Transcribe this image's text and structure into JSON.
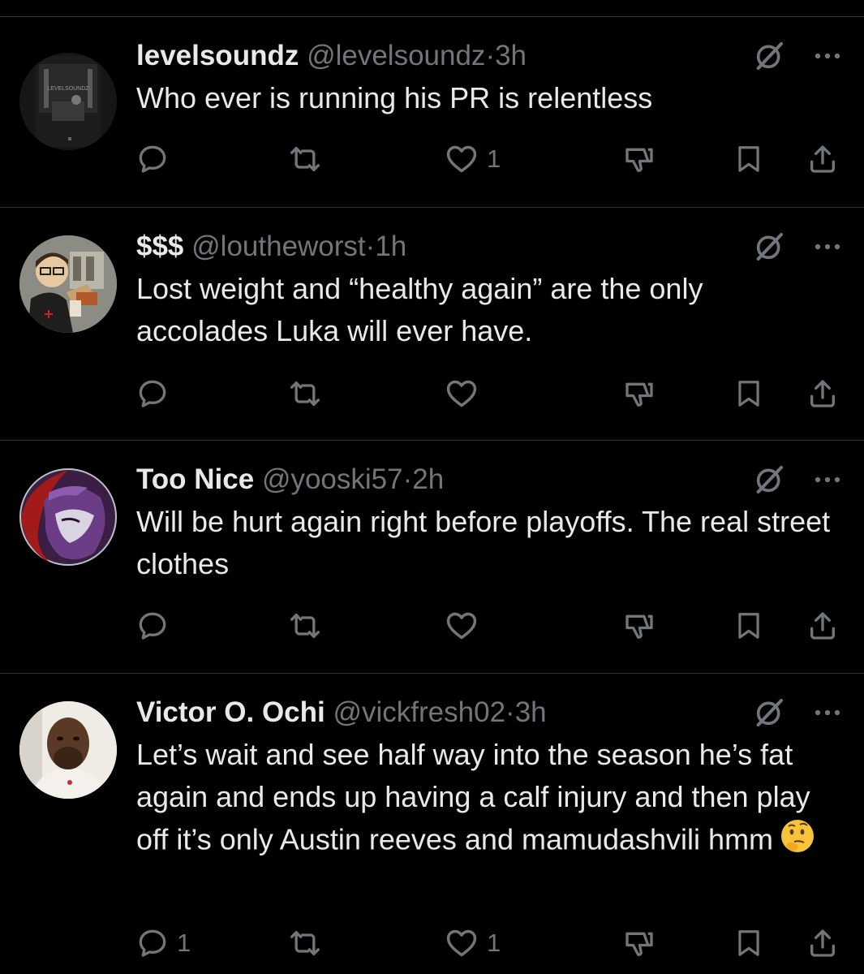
{
  "colors": {
    "background": "#000000",
    "text_primary": "#e7e9ea",
    "text_secondary": "#71767b",
    "divider": "#2f3336"
  },
  "tweets": [
    {
      "name": "levelsoundz",
      "handle": "@levelsoundz",
      "separator": "·",
      "time": "3h",
      "text": "Who ever is running his PR is relentless",
      "avatar_text": "LEVELSOUNDZ",
      "reply_count": "",
      "like_count": "1"
    },
    {
      "name": "$$$",
      "handle": "@loutheworst",
      "separator": "·",
      "time": "1h",
      "text": "Lost weight and “healthy again” are the only accolades Luka will ever have.",
      "reply_count": "",
      "like_count": ""
    },
    {
      "name": "Too Nice",
      "handle": "@yooski57",
      "separator": "·",
      "time": "2h",
      "text": "Will be hurt again right before playoffs. The real street clothes",
      "reply_count": "",
      "like_count": ""
    },
    {
      "name": "Victor O. Ochi",
      "handle": "@vickfresh02",
      "separator": "·",
      "time": "3h",
      "text": "Let’s wait and see half way into the season he’s fat again and ends up having a calf injury and then play off it’s only Austin reeves and mamudashvili hmm",
      "emoji": "thinking-face-emoji",
      "reply_count": "1",
      "like_count": "1"
    }
  ],
  "icons": {
    "grok": "grok-icon",
    "more": "more-icon",
    "reply": "reply-icon",
    "repost": "repost-icon",
    "like": "like-icon",
    "dislike": "dislike-icon",
    "bookmark": "bookmark-icon",
    "share": "share-icon"
  }
}
